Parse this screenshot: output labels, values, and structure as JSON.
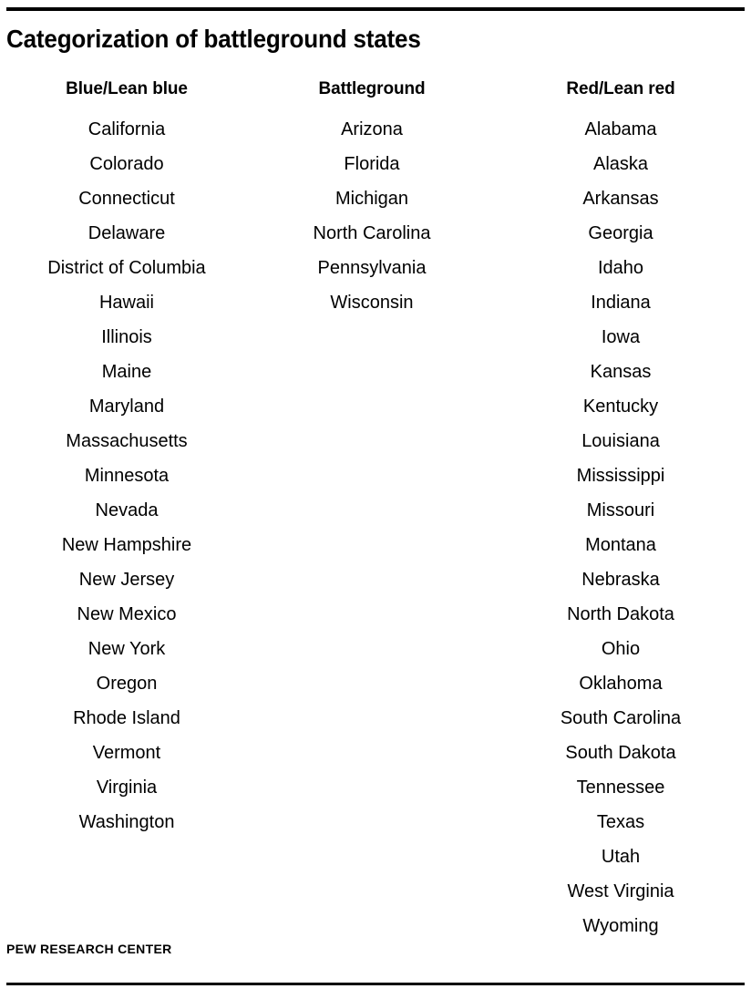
{
  "figure": {
    "title": "Categorization of battleground states",
    "source_label": "PEW RESEARCH CENTER"
  },
  "columns": [
    {
      "id": "blue",
      "header": "Blue/Lean blue",
      "states": [
        "California",
        "Colorado",
        "Connecticut",
        "Delaware",
        "District of Columbia",
        "Hawaii",
        "Illinois",
        "Maine",
        "Maryland",
        "Massachusetts",
        "Minnesota",
        "Nevada",
        "New Hampshire",
        "New Jersey",
        "New Mexico",
        "New York",
        "Oregon",
        "Rhode Island",
        "Vermont",
        "Virginia",
        "Washington"
      ]
    },
    {
      "id": "battleground",
      "header": "Battleground",
      "states": [
        "Arizona",
        "Florida",
        "Michigan",
        "North Carolina",
        "Pennsylvania",
        "Wisconsin"
      ]
    },
    {
      "id": "red",
      "header": "Red/Lean red",
      "states": [
        "Alabama",
        "Alaska",
        "Arkansas",
        "Georgia",
        "Idaho",
        "Indiana",
        "Iowa",
        "Kansas",
        "Kentucky",
        "Louisiana",
        "Mississippi",
        "Missouri",
        "Montana",
        "Nebraska",
        "North Dakota",
        "Ohio",
        "Oklahoma",
        "South Carolina",
        "South Dakota",
        "Tennessee",
        "Texas",
        "Utah",
        "West Virginia",
        "Wyoming"
      ]
    }
  ],
  "chart_data": {
    "type": "table",
    "title": "Categorization of battleground states",
    "columns": [
      "Blue/Lean blue",
      "Battleground",
      "Red/Lean red"
    ],
    "counts": [
      21,
      6,
      24
    ],
    "rows": [
      [
        "California",
        "Arizona",
        "Alabama"
      ],
      [
        "Colorado",
        "Florida",
        "Alaska"
      ],
      [
        "Connecticut",
        "Michigan",
        "Arkansas"
      ],
      [
        "Delaware",
        "North Carolina",
        "Georgia"
      ],
      [
        "District of Columbia",
        "Pennsylvania",
        "Idaho"
      ],
      [
        "Hawaii",
        "Wisconsin",
        "Indiana"
      ],
      [
        "Illinois",
        "",
        "Iowa"
      ],
      [
        "Maine",
        "",
        "Kansas"
      ],
      [
        "Maryland",
        "",
        "Kentucky"
      ],
      [
        "Massachusetts",
        "",
        "Louisiana"
      ],
      [
        "Minnesota",
        "",
        "Mississippi"
      ],
      [
        "Nevada",
        "",
        "Missouri"
      ],
      [
        "New Hampshire",
        "",
        "Montana"
      ],
      [
        "New Jersey",
        "",
        "Nebraska"
      ],
      [
        "New Mexico",
        "",
        "North Dakota"
      ],
      [
        "New York",
        "",
        "Ohio"
      ],
      [
        "Oregon",
        "",
        "Oklahoma"
      ],
      [
        "Rhode Island",
        "",
        "South Carolina"
      ],
      [
        "Vermont",
        "",
        "South Dakota"
      ],
      [
        "Virginia",
        "",
        "Tennessee"
      ],
      [
        "Washington",
        "",
        "Texas"
      ],
      [
        "",
        "",
        "Utah"
      ],
      [
        "",
        "",
        "West Virginia"
      ],
      [
        "",
        "",
        "Wyoming"
      ]
    ],
    "source": "PEW RESEARCH CENTER"
  },
  "colors": {
    "text": "#000000",
    "background": "#ffffff",
    "rule": "#000000"
  }
}
